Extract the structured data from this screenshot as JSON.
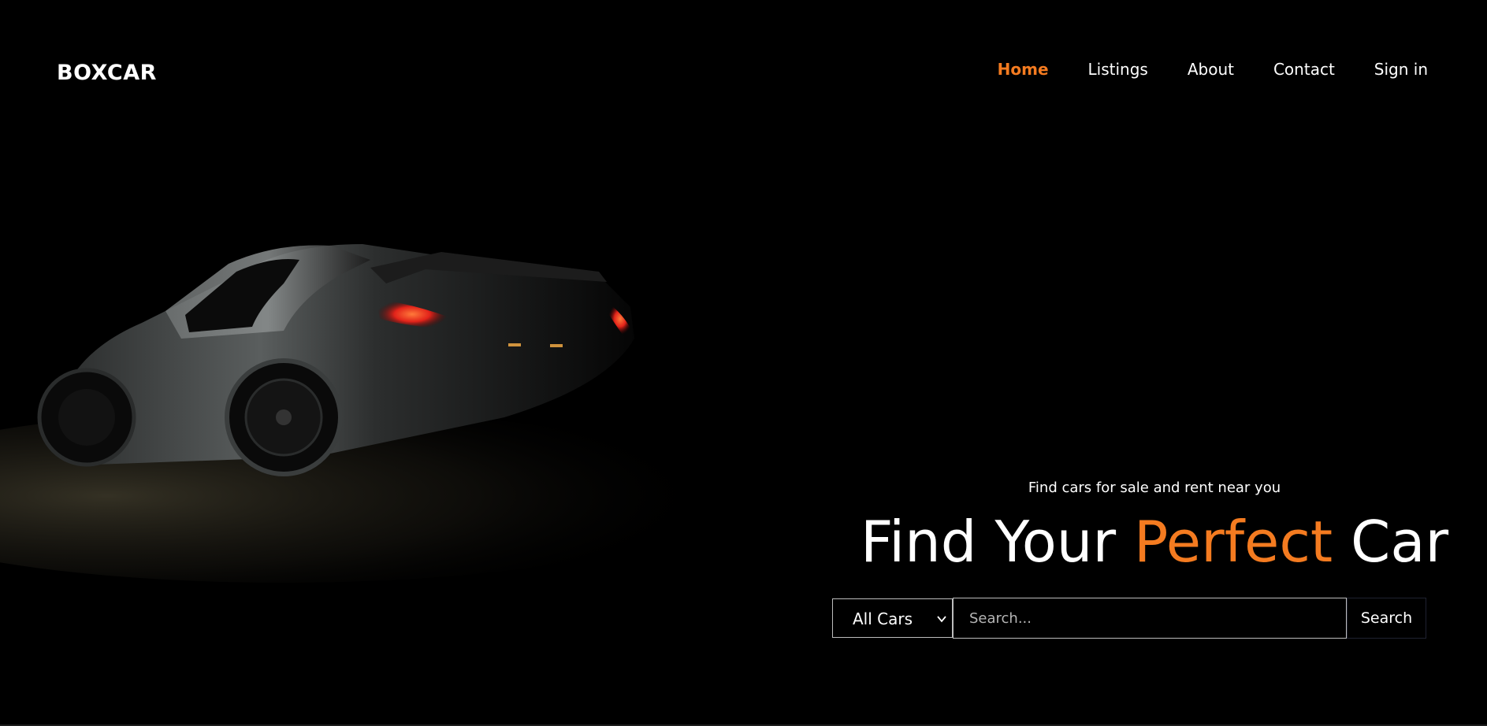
{
  "header": {
    "logo": "BOXCAR",
    "nav": [
      {
        "label": "Home",
        "active": true
      },
      {
        "label": "Listings",
        "active": false
      },
      {
        "label": "About",
        "active": false
      },
      {
        "label": "Contact",
        "active": false
      },
      {
        "label": "Sign in",
        "active": false
      }
    ]
  },
  "hero": {
    "tagline": "Find cars for sale and rent near you",
    "headline_part1": "Find Your ",
    "headline_accent": "Perfect",
    "headline_part2": " Car",
    "background_image": "black sports car in darkness with lit tail lights"
  },
  "search": {
    "category_selected": "All Cars",
    "placeholder": "Search...",
    "button_label": "Search"
  },
  "colors": {
    "accent": "#f47b20",
    "background": "#000000",
    "text": "#ffffff"
  }
}
